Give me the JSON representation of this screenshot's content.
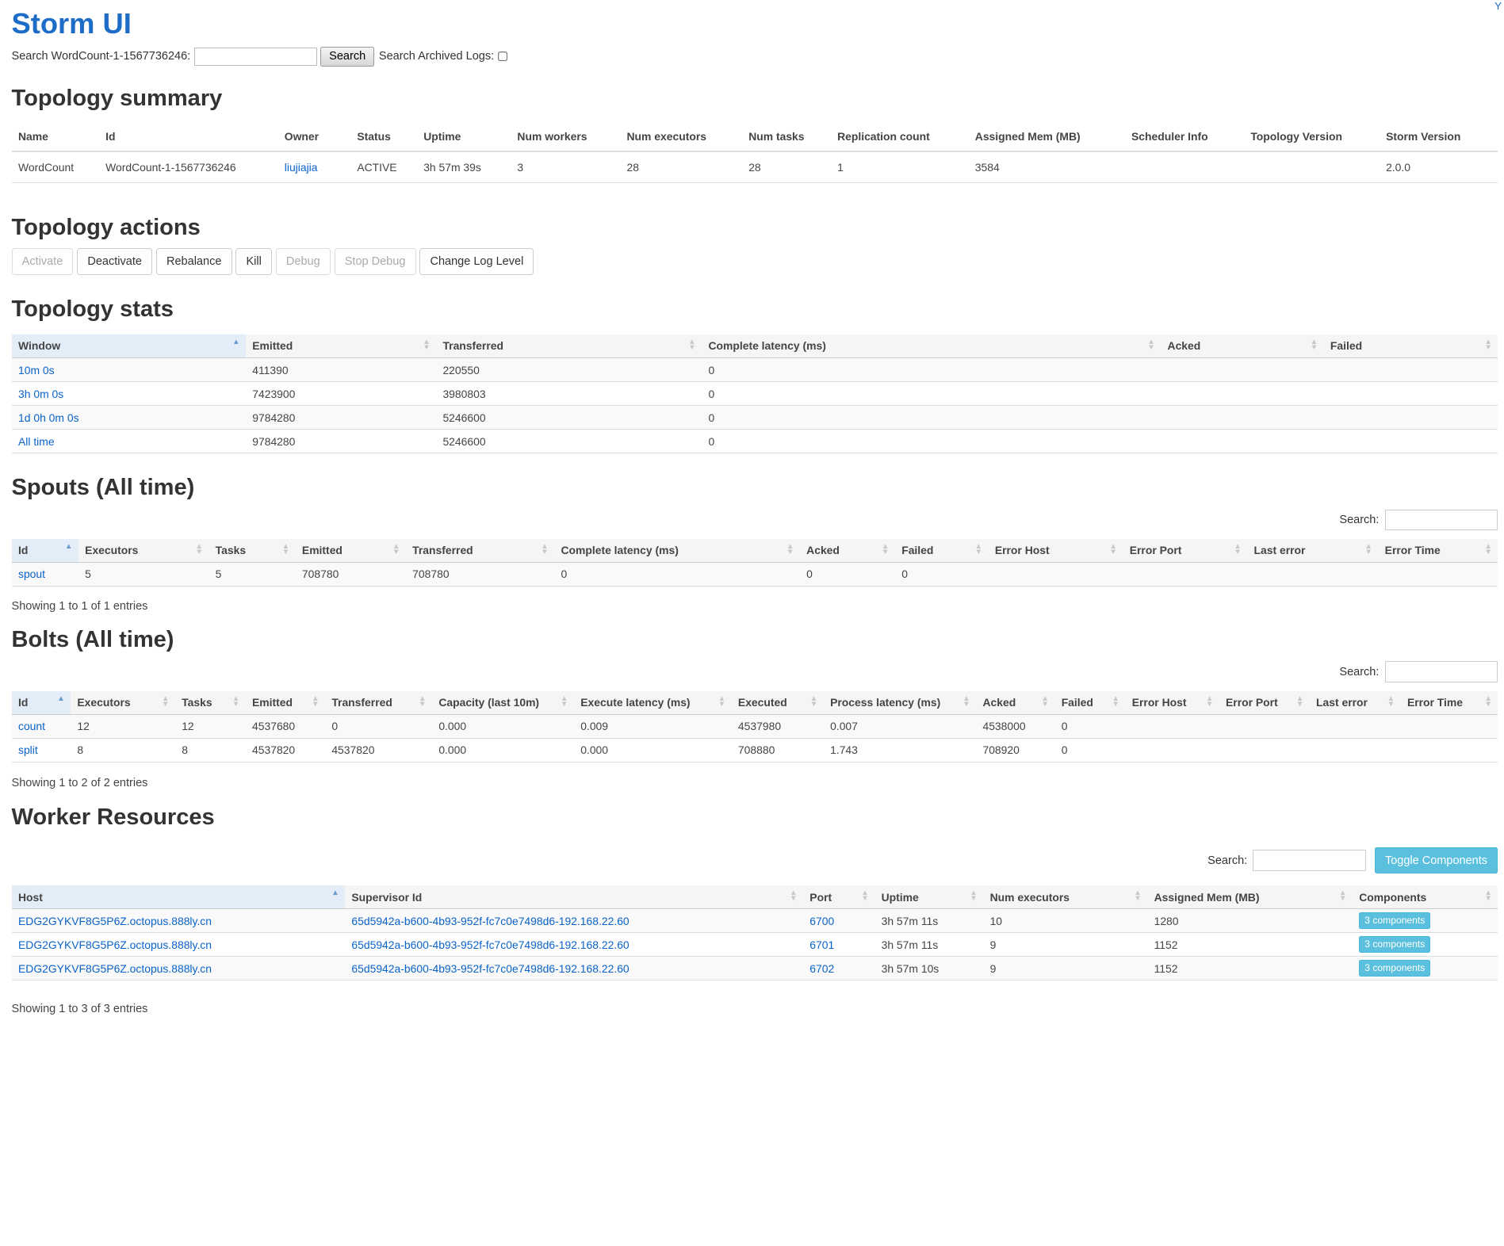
{
  "app": {
    "title": "Storm UI"
  },
  "search": {
    "label": "Search WordCount-1-1567736246:",
    "button": "Search",
    "archived_label": "Search Archived Logs:"
  },
  "summary": {
    "heading": "Topology summary",
    "headers": [
      "Name",
      "Id",
      "Owner",
      "Status",
      "Uptime",
      "Num workers",
      "Num executors",
      "Num tasks",
      "Replication count",
      "Assigned Mem (MB)",
      "Scheduler Info",
      "Topology Version",
      "Storm Version"
    ],
    "row": {
      "name": "WordCount",
      "id": "WordCount-1-1567736246",
      "owner": "liujiajia",
      "status": "ACTIVE",
      "uptime": "3h 57m 39s",
      "workers": "3",
      "executors": "28",
      "tasks": "28",
      "replication": "1",
      "mem": "3584",
      "scheduler": "",
      "topo_version": "",
      "storm_version": "2.0.0"
    }
  },
  "actions": {
    "heading": "Topology actions",
    "activate": "Activate",
    "deactivate": "Deactivate",
    "rebalance": "Rebalance",
    "kill": "Kill",
    "debug": "Debug",
    "stop_debug": "Stop Debug",
    "log_level": "Change Log Level"
  },
  "stats": {
    "heading": "Topology stats",
    "headers": [
      "Window",
      "Emitted",
      "Transferred",
      "Complete latency (ms)",
      "Acked",
      "Failed"
    ],
    "rows": [
      {
        "window": "10m 0s",
        "emitted": "411390",
        "transferred": "220550",
        "latency": "0",
        "acked": "",
        "failed": ""
      },
      {
        "window": "3h 0m 0s",
        "emitted": "7423900",
        "transferred": "3980803",
        "latency": "0",
        "acked": "",
        "failed": ""
      },
      {
        "window": "1d 0h 0m 0s",
        "emitted": "9784280",
        "transferred": "5246600",
        "latency": "0",
        "acked": "",
        "failed": ""
      },
      {
        "window": "All time",
        "emitted": "9784280",
        "transferred": "5246600",
        "latency": "0",
        "acked": "",
        "failed": ""
      }
    ]
  },
  "spouts": {
    "heading": "Spouts (All time)",
    "search_label": "Search:",
    "headers": [
      "Id",
      "Executors",
      "Tasks",
      "Emitted",
      "Transferred",
      "Complete latency (ms)",
      "Acked",
      "Failed",
      "Error Host",
      "Error Port",
      "Last error",
      "Error Time"
    ],
    "rows": [
      {
        "id": "spout",
        "executors": "5",
        "tasks": "5",
        "emitted": "708780",
        "transferred": "708780",
        "latency": "0",
        "acked": "0",
        "failed": "0"
      }
    ],
    "showing": "Showing 1 to 1 of 1 entries"
  },
  "bolts": {
    "heading": "Bolts (All time)",
    "search_label": "Search:",
    "headers": [
      "Id",
      "Executors",
      "Tasks",
      "Emitted",
      "Transferred",
      "Capacity (last 10m)",
      "Execute latency (ms)",
      "Executed",
      "Process latency (ms)",
      "Acked",
      "Failed",
      "Error Host",
      "Error Port",
      "Last error",
      "Error Time"
    ],
    "rows": [
      {
        "id": "count",
        "executors": "12",
        "tasks": "12",
        "emitted": "4537680",
        "transferred": "0",
        "capacity": "0.000",
        "exec_latency": "0.009",
        "executed": "4537980",
        "proc_latency": "0.007",
        "acked": "4538000",
        "failed": "0"
      },
      {
        "id": "split",
        "executors": "8",
        "tasks": "8",
        "emitted": "4537820",
        "transferred": "4537820",
        "capacity": "0.000",
        "exec_latency": "0.000",
        "executed": "708880",
        "proc_latency": "1.743",
        "acked": "708920",
        "failed": "0"
      }
    ],
    "showing": "Showing 1 to 2 of 2 entries"
  },
  "workers": {
    "heading": "Worker Resources",
    "search_label": "Search:",
    "toggle": "Toggle Components",
    "headers": [
      "Host",
      "Supervisor Id",
      "Port",
      "Uptime",
      "Num executors",
      "Assigned Mem (MB)",
      "Components"
    ],
    "rows": [
      {
        "host": "EDG2GYKVF8G5P6Z.octopus.888ly.cn",
        "supervisor": "65d5942a-b600-4b93-952f-fc7c0e7498d6-192.168.22.60",
        "port": "6700",
        "uptime": "3h 57m 11s",
        "executors": "10",
        "mem": "1280",
        "components": "3 components"
      },
      {
        "host": "EDG2GYKVF8G5P6Z.octopus.888ly.cn",
        "supervisor": "65d5942a-b600-4b93-952f-fc7c0e7498d6-192.168.22.60",
        "port": "6701",
        "uptime": "3h 57m 11s",
        "executors": "9",
        "mem": "1152",
        "components": "3 components"
      },
      {
        "host": "EDG2GYKVF8G5P6Z.octopus.888ly.cn",
        "supervisor": "65d5942a-b600-4b93-952f-fc7c0e7498d6-192.168.22.60",
        "port": "6702",
        "uptime": "3h 57m 10s",
        "executors": "9",
        "mem": "1152",
        "components": "3 components"
      }
    ],
    "showing": "Showing 1 to 3 of 3 entries"
  }
}
